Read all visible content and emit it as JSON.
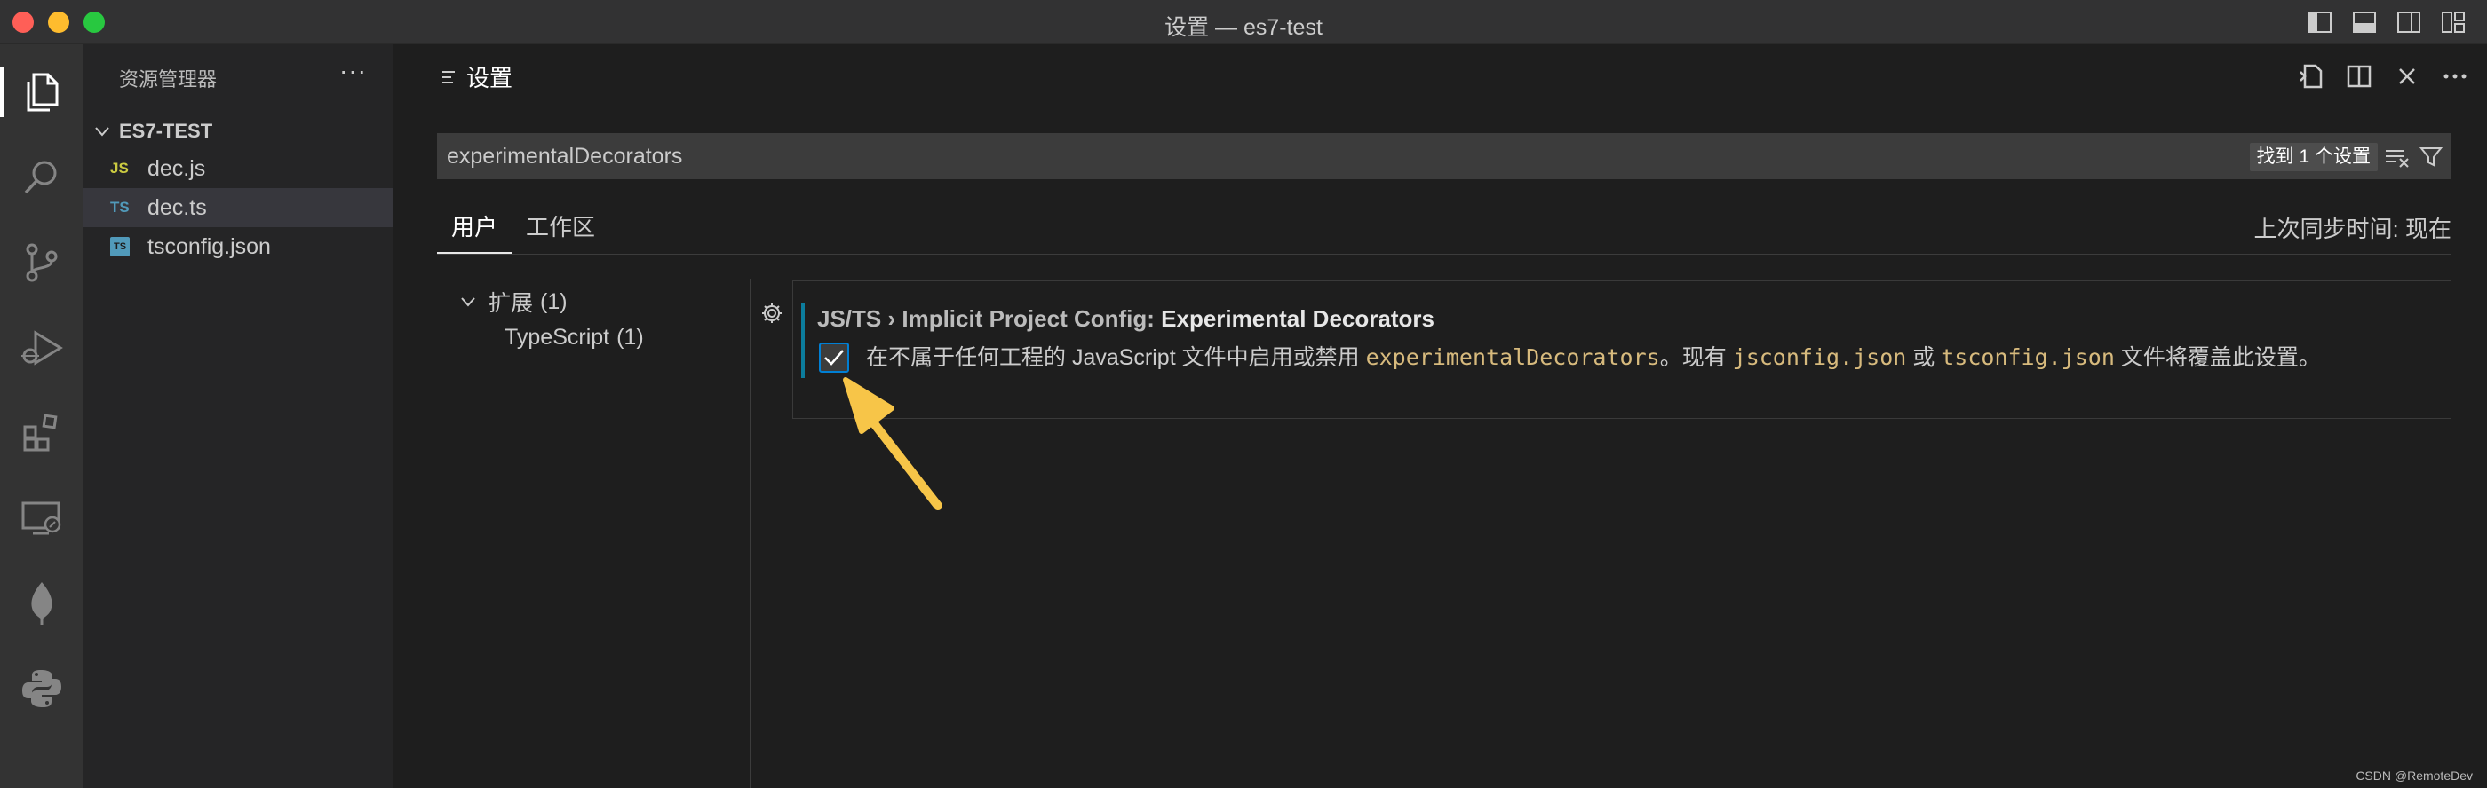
{
  "window": {
    "title": "设置 — es7-test"
  },
  "sidebar": {
    "header": "资源管理器",
    "more": "···",
    "folder": "ES7-TEST",
    "files": [
      {
        "icon_text": "JS",
        "name": "dec.js"
      },
      {
        "icon_text": "TS",
        "name": "dec.ts"
      },
      {
        "icon_text": "TS",
        "name": "tsconfig.json"
      }
    ]
  },
  "editor": {
    "tab_label": "设置"
  },
  "search": {
    "value": "experimentalDecorators",
    "result_badge": "找到 1 个设置"
  },
  "scopes": {
    "user": "用户",
    "workspace": "工作区",
    "sync": "上次同步时间: 现在"
  },
  "toc": {
    "extensions_label": "扩展",
    "extensions_count": "(1)",
    "typescript_label": "TypeScript",
    "typescript_count": "(1)"
  },
  "setting": {
    "category": "JS/TS › Implicit Project Config: ",
    "key": "Experimental Decorators",
    "checked": true,
    "desc_1": "在不属于任何工程的 JavaScript 文件中启用或禁用 ",
    "code_1": "experimentalDecorators",
    "desc_2": "。现有 ",
    "code_2": "jsconfig.json",
    "desc_3": " 或 ",
    "code_3": "tsconfig.json",
    "desc_4": " 文件将覆盖此设置。"
  },
  "watermark": "CSDN @RemoteDev",
  "colors": {
    "accent": "#007fd4",
    "arrow": "#f7c548",
    "setting_bar": "#0c7d9d",
    "code": "#d7ba7d"
  },
  "icons": {
    "activity": [
      "files-icon",
      "search-icon",
      "source-control-icon",
      "run-debug-icon",
      "extensions-icon",
      "remote-explorer-icon",
      "mongodb-icon",
      "python-icon"
    ],
    "editor_actions": [
      "open-settings-json-icon",
      "split-editor-icon",
      "close-icon",
      "more-actions-icon"
    ]
  }
}
